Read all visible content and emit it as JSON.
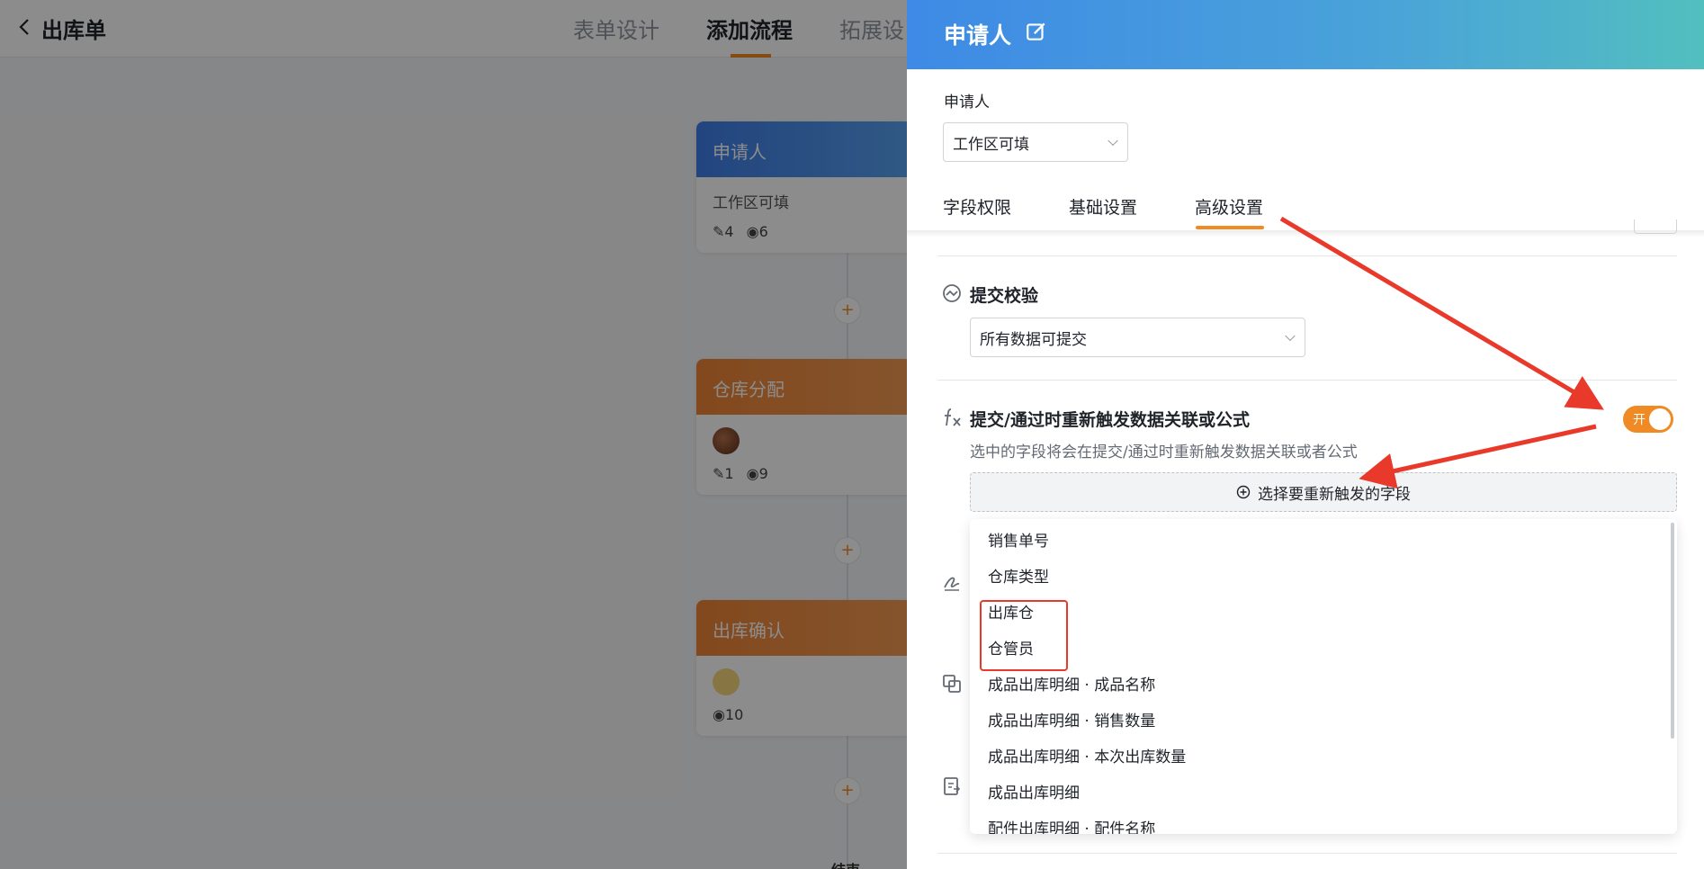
{
  "app": {
    "title": "出库单"
  },
  "top_tabs": [
    {
      "label": "表单设计"
    },
    {
      "label": "添加流程"
    },
    {
      "label": "拓展设"
    }
  ],
  "flow": {
    "nodes": [
      {
        "title": "申请人",
        "subtitle": "工作区可填",
        "edit_count": "4",
        "view_count": "6"
      },
      {
        "title": "仓库分配",
        "edit_count": "1",
        "view_count": "9"
      },
      {
        "title": "出库确认",
        "view_count": "10"
      }
    ],
    "add_symbol": "+",
    "end_label": "结束"
  },
  "drawer": {
    "title": "申请人",
    "field_label": "申请人",
    "permission_select": "工作区可填",
    "tabs": [
      {
        "label": "字段权限"
      },
      {
        "label": "基础设置"
      },
      {
        "label": "高级设置"
      }
    ],
    "submit_check": {
      "title": "提交校验",
      "value": "所有数据可提交"
    },
    "retrigger": {
      "title": "提交/通过时重新触发数据关联或公式",
      "description": "选中的字段将会在提交/通过时重新触发数据关联或者公式",
      "toggle_label": "开",
      "toggle_on": true,
      "select_button": "选择要重新触发的字段",
      "options": [
        "销售单号",
        "仓库类型",
        "出库仓",
        "仓管员",
        "成品出库明细 · 成品名称",
        "成品出库明细 · 销售数量",
        "成品出库明细 · 本次出库数量",
        "成品出库明细",
        "配件出库明细 · 配件名称"
      ]
    }
  },
  "colors": {
    "accent": "#f08a24",
    "annotation": "#e8392a",
    "header_blue": "#3e8ae6"
  }
}
